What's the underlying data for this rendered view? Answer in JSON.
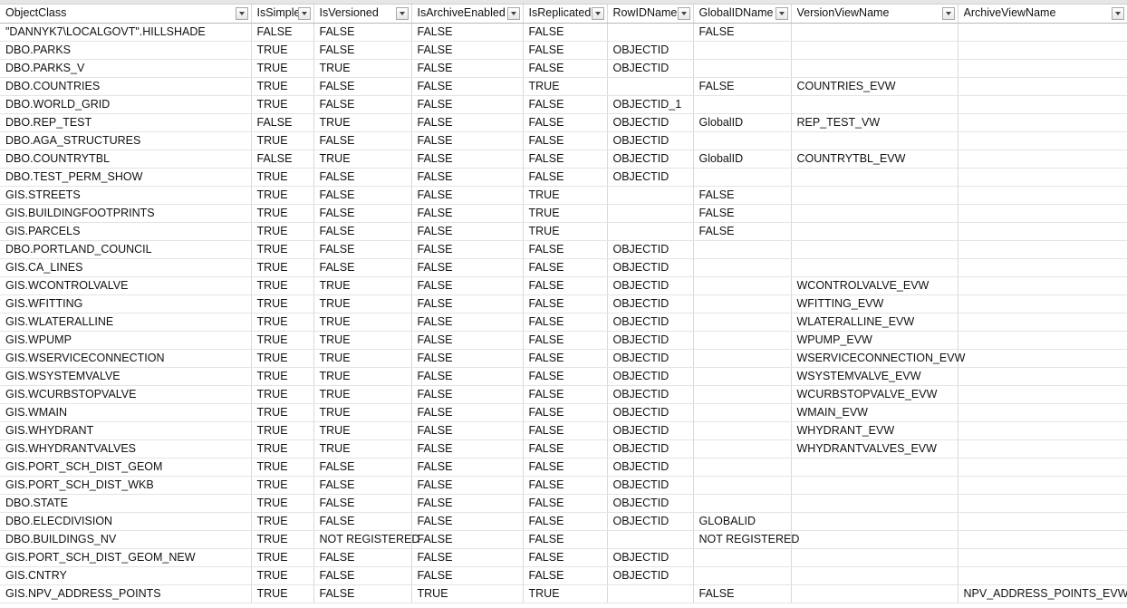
{
  "columns": [
    {
      "key": "ObjectClass",
      "label": "ObjectClass"
    },
    {
      "key": "IsSimple",
      "label": "IsSimple"
    },
    {
      "key": "IsVersioned",
      "label": "IsVersioned"
    },
    {
      "key": "IsArchiveEnabled",
      "label": "IsArchiveEnabled"
    },
    {
      "key": "IsReplicated",
      "label": "IsReplicated"
    },
    {
      "key": "RowIDName",
      "label": "RowIDName"
    },
    {
      "key": "GlobalIDName",
      "label": "GlobalIDName"
    },
    {
      "key": "VersionViewName",
      "label": "VersionViewName"
    },
    {
      "key": "ArchiveViewName",
      "label": "ArchiveViewName"
    }
  ],
  "rows": [
    [
      "\"DANNYK7\\LOCALGOVT\".HILLSHADE",
      "FALSE",
      "FALSE",
      "FALSE",
      "FALSE",
      "",
      "FALSE",
      "",
      ""
    ],
    [
      "DBO.PARKS",
      "TRUE",
      "FALSE",
      "FALSE",
      "FALSE",
      "OBJECTID",
      "",
      "",
      ""
    ],
    [
      "DBO.PARKS_V",
      "TRUE",
      "TRUE",
      "FALSE",
      "FALSE",
      "OBJECTID",
      "",
      "",
      ""
    ],
    [
      "DBO.COUNTRIES",
      "TRUE",
      "FALSE",
      "FALSE",
      "TRUE",
      "",
      "FALSE",
      "COUNTRIES_EVW",
      ""
    ],
    [
      "DBO.WORLD_GRID",
      "TRUE",
      "FALSE",
      "FALSE",
      "FALSE",
      "OBJECTID_1",
      "",
      "",
      ""
    ],
    [
      "DBO.REP_TEST",
      "FALSE",
      "TRUE",
      "FALSE",
      "FALSE",
      "OBJECTID",
      "GlobalID",
      "REP_TEST_VW",
      ""
    ],
    [
      "DBO.AGA_STRUCTURES",
      "TRUE",
      "FALSE",
      "FALSE",
      "FALSE",
      "OBJECTID",
      "",
      "",
      ""
    ],
    [
      "DBO.COUNTRYTBL",
      "FALSE",
      "TRUE",
      "FALSE",
      "FALSE",
      "OBJECTID",
      "GlobalID",
      "COUNTRYTBL_EVW",
      ""
    ],
    [
      "DBO.TEST_PERM_SHOW",
      "TRUE",
      "FALSE",
      "FALSE",
      "FALSE",
      "OBJECTID",
      "",
      "",
      ""
    ],
    [
      "GIS.STREETS",
      "TRUE",
      "FALSE",
      "FALSE",
      "TRUE",
      "",
      "FALSE",
      "",
      ""
    ],
    [
      "GIS.BUILDINGFOOTPRINTS",
      "TRUE",
      "FALSE",
      "FALSE",
      "TRUE",
      "",
      "FALSE",
      "",
      ""
    ],
    [
      "GIS.PARCELS",
      "TRUE",
      "FALSE",
      "FALSE",
      "TRUE",
      "",
      "FALSE",
      "",
      ""
    ],
    [
      "DBO.PORTLAND_COUNCIL",
      "TRUE",
      "FALSE",
      "FALSE",
      "FALSE",
      "OBJECTID",
      "",
      "",
      ""
    ],
    [
      "GIS.CA_LINES",
      "TRUE",
      "FALSE",
      "FALSE",
      "FALSE",
      "OBJECTID",
      "",
      "",
      ""
    ],
    [
      "GIS.WCONTROLVALVE",
      "TRUE",
      "TRUE",
      "FALSE",
      "FALSE",
      "OBJECTID",
      "",
      "WCONTROLVALVE_EVW",
      ""
    ],
    [
      "GIS.WFITTING",
      "TRUE",
      "TRUE",
      "FALSE",
      "FALSE",
      "OBJECTID",
      "",
      "WFITTING_EVW",
      ""
    ],
    [
      "GIS.WLATERALLINE",
      "TRUE",
      "TRUE",
      "FALSE",
      "FALSE",
      "OBJECTID",
      "",
      "WLATERALLINE_EVW",
      ""
    ],
    [
      "GIS.WPUMP",
      "TRUE",
      "TRUE",
      "FALSE",
      "FALSE",
      "OBJECTID",
      "",
      "WPUMP_EVW",
      ""
    ],
    [
      "GIS.WSERVICECONNECTION",
      "TRUE",
      "TRUE",
      "FALSE",
      "FALSE",
      "OBJECTID",
      "",
      "WSERVICECONNECTION_EVW",
      ""
    ],
    [
      "GIS.WSYSTEMVALVE",
      "TRUE",
      "TRUE",
      "FALSE",
      "FALSE",
      "OBJECTID",
      "",
      "WSYSTEMVALVE_EVW",
      ""
    ],
    [
      "GIS.WCURBSTOPVALVE",
      "TRUE",
      "TRUE",
      "FALSE",
      "FALSE",
      "OBJECTID",
      "",
      "WCURBSTOPVALVE_EVW",
      ""
    ],
    [
      "GIS.WMAIN",
      "TRUE",
      "TRUE",
      "FALSE",
      "FALSE",
      "OBJECTID",
      "",
      "WMAIN_EVW",
      ""
    ],
    [
      "GIS.WHYDRANT",
      "TRUE",
      "TRUE",
      "FALSE",
      "FALSE",
      "OBJECTID",
      "",
      "WHYDRANT_EVW",
      ""
    ],
    [
      "GIS.WHYDRANTVALVES",
      "TRUE",
      "TRUE",
      "FALSE",
      "FALSE",
      "OBJECTID",
      "",
      "WHYDRANTVALVES_EVW",
      ""
    ],
    [
      "GIS.PORT_SCH_DIST_GEOM",
      "TRUE",
      "FALSE",
      "FALSE",
      "FALSE",
      "OBJECTID",
      "",
      "",
      ""
    ],
    [
      "GIS.PORT_SCH_DIST_WKB",
      "TRUE",
      "FALSE",
      "FALSE",
      "FALSE",
      "OBJECTID",
      "",
      "",
      ""
    ],
    [
      "DBO.STATE",
      "TRUE",
      "FALSE",
      "FALSE",
      "FALSE",
      "OBJECTID",
      "",
      "",
      ""
    ],
    [
      "DBO.ELECDIVISION",
      "TRUE",
      "FALSE",
      "FALSE",
      "FALSE",
      "OBJECTID",
      "GLOBALID",
      "",
      ""
    ],
    [
      "DBO.BUILDINGS_NV",
      "TRUE",
      "NOT REGISTERED",
      "FALSE",
      "FALSE",
      "",
      "NOT REGISTERED",
      "",
      ""
    ],
    [
      "GIS.PORT_SCH_DIST_GEOM_NEW",
      "TRUE",
      "FALSE",
      "FALSE",
      "FALSE",
      "OBJECTID",
      "",
      "",
      ""
    ],
    [
      "GIS.CNTRY",
      "TRUE",
      "FALSE",
      "FALSE",
      "FALSE",
      "OBJECTID",
      "",
      "",
      ""
    ],
    [
      "GIS.NPV_ADDRESS_POINTS",
      "TRUE",
      "FALSE",
      "TRUE",
      "TRUE",
      "",
      "FALSE",
      "",
      "NPV_ADDRESS_POINTS_EVW"
    ]
  ]
}
